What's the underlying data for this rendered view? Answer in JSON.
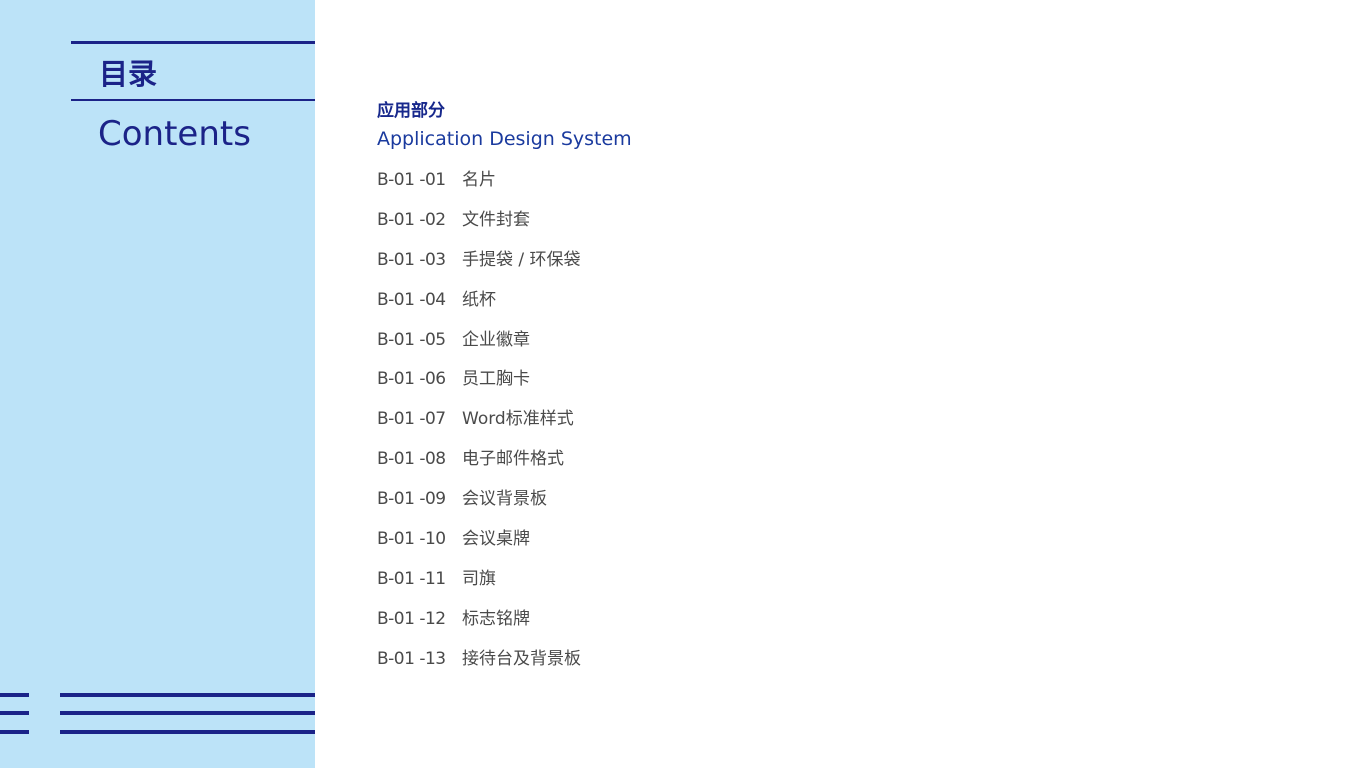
{
  "sidebar": {
    "title_cn": "目录",
    "title_en": "Contents",
    "colors": {
      "background": "#bce3f8",
      "accent": "#1b2388"
    }
  },
  "main": {
    "section": {
      "title_cn": "应用部分",
      "title_en": "Application Design System"
    },
    "items": [
      {
        "code": "B-01 -01",
        "name": "名片"
      },
      {
        "code": "B-01 -02",
        "name": "文件封套"
      },
      {
        "code": "B-01 -03",
        "name": "手提袋 / 环保袋"
      },
      {
        "code": "B-01 -04",
        "name": "纸杯"
      },
      {
        "code": "B-01 -05",
        "name": "企业徽章"
      },
      {
        "code": "B-01 -06",
        "name": "员工胸卡"
      },
      {
        "code": "B-01 -07",
        "name": "Word标准样式"
      },
      {
        "code": "B-01 -08",
        "name": "电子邮件格式"
      },
      {
        "code": "B-01 -09",
        "name": "会议背景板"
      },
      {
        "code": "B-01 -10",
        "name": "会议桌牌"
      },
      {
        "code": "B-01 -11",
        "name": "司旗"
      },
      {
        "code": "B-01 -12",
        "name": "标志铭牌"
      },
      {
        "code": "B-01 -13",
        "name": "接待台及背景板"
      }
    ]
  }
}
